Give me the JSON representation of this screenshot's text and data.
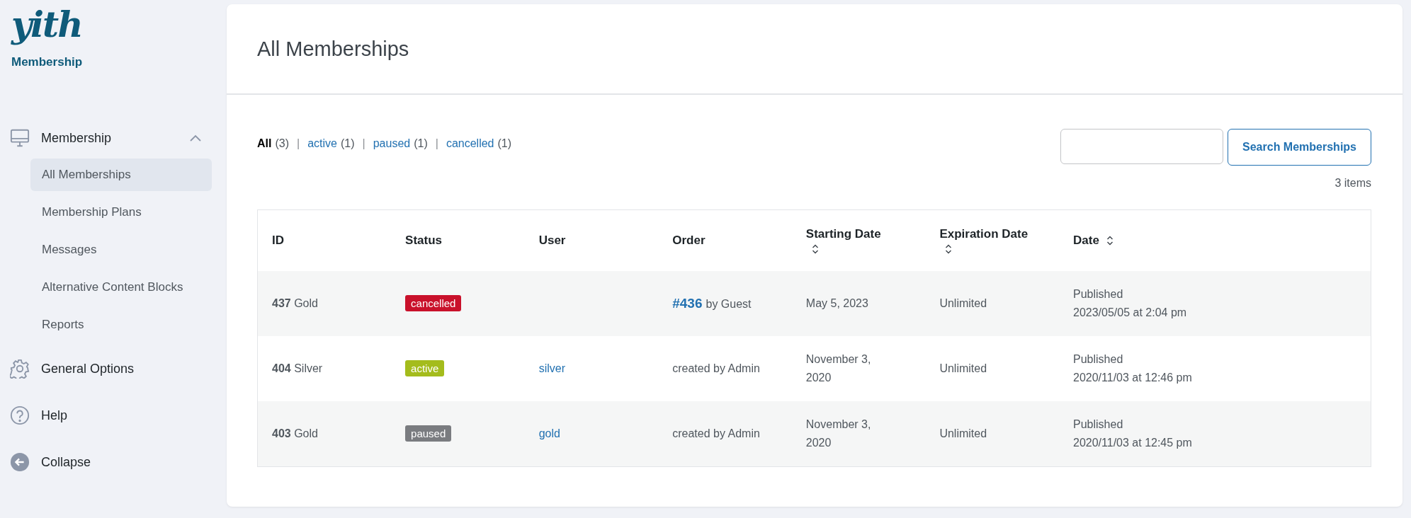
{
  "sidebar": {
    "logo": "yith",
    "product": "Membership",
    "menu": [
      {
        "label": "Membership",
        "expanded": true,
        "children": [
          {
            "label": "All Memberships",
            "selected": true
          },
          {
            "label": "Membership Plans",
            "selected": false
          },
          {
            "label": "Messages",
            "selected": false
          },
          {
            "label": "Alternative Content Blocks",
            "selected": false
          },
          {
            "label": "Reports",
            "selected": false
          }
        ]
      },
      {
        "label": "General Options"
      },
      {
        "label": "Help"
      },
      {
        "label": "Collapse"
      }
    ]
  },
  "page_title": "All Memberships",
  "filters": [
    {
      "label": "All",
      "count": "(3)",
      "selected": true
    },
    {
      "separator": "|",
      "label": "active",
      "count": "(1)",
      "selected": false
    },
    {
      "separator": "|",
      "label": "paused",
      "count": "(1)",
      "selected": false
    },
    {
      "separator": "|",
      "label": "cancelled",
      "count": "(1)",
      "selected": false
    }
  ],
  "search": {
    "button": "Search Memberships"
  },
  "item_count": "3 items",
  "table": {
    "columns": [
      {
        "label": "ID",
        "sortable": false
      },
      {
        "label": "Status",
        "sortable": false
      },
      {
        "label": "User",
        "sortable": false
      },
      {
        "label": "Order",
        "sortable": false
      },
      {
        "label": "Starting Date",
        "sortable": true
      },
      {
        "label": "Expiration Date",
        "sortable": true
      },
      {
        "label": "Date",
        "sortable": true
      }
    ],
    "rows": [
      {
        "id": "**437** Gold",
        "status": "cancelled",
        "color": "#c9112b",
        "order_link": "#436",
        "order_text": "by Guest",
        "start": "May 5, 2023",
        "expiration": "Unlimited",
        "date": "Published",
        "date_detail": "2023/05/05 at 2:04 pm"
      },
      {
        "id": "**404** Silver",
        "status": "active",
        "color": "#a4bc1c",
        "user": "silver",
        "order_text": "created by Admin",
        "start": "November 3, 2020",
        "expiration": "Unlimited",
        "date": "Published",
        "date_detail": "2020/11/03 at 12:46 pm"
      },
      {
        "id": "**403** Gold",
        "status": "paused",
        "color": "#7a7c80",
        "user": "gold",
        "order_text": "created by Admin",
        "start": "November 3, 2020",
        "expiration": "Unlimited",
        "date": "Published",
        "date_detail": "2020/11/03 at 12:45 pm"
      }
    ]
  }
}
